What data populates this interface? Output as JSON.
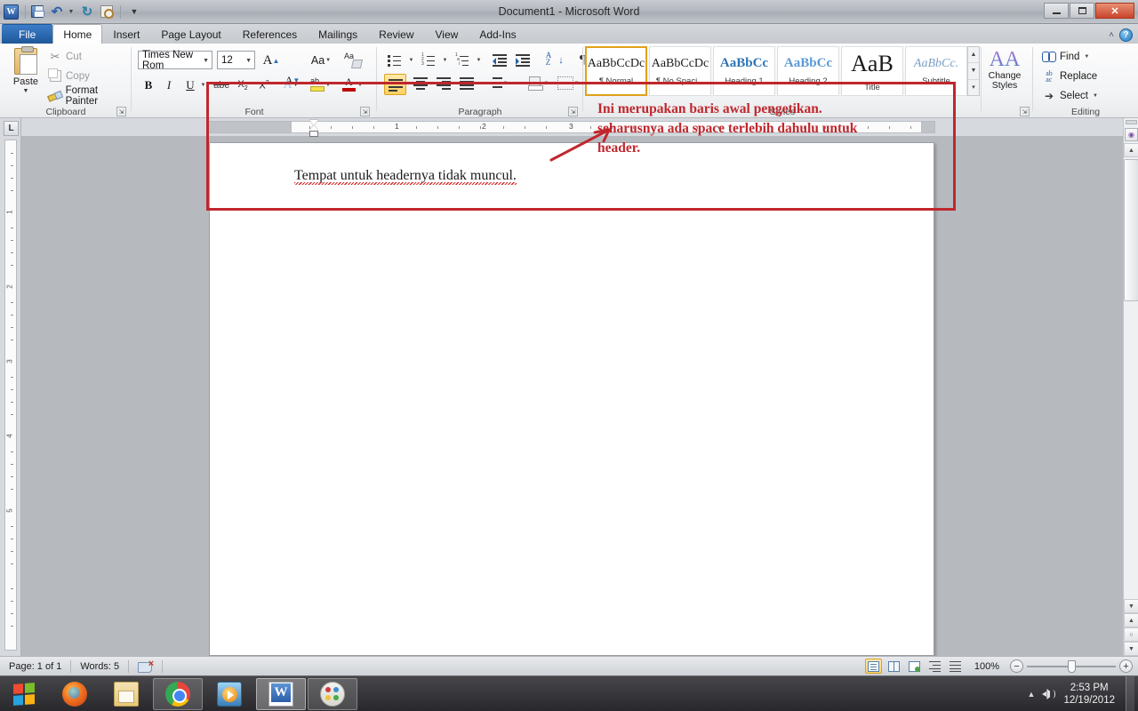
{
  "titlebar": {
    "app_icon": "word-logo",
    "document_title": "Document1  -  Microsoft Word",
    "qat": [
      {
        "name": "save",
        "icon": "save-icon",
        "label": "Save"
      },
      {
        "name": "undo",
        "icon": "undo-icon",
        "label": "Undo"
      },
      {
        "name": "redo",
        "icon": "redo-icon",
        "label": "Redo"
      },
      {
        "name": "print-preview",
        "icon": "print-preview-icon",
        "label": "Print Preview and Print"
      },
      {
        "name": "customize-qat",
        "icon": "chevron-down-icon",
        "label": "Customize Quick Access Toolbar"
      }
    ],
    "window_controls": [
      {
        "name": "minimize",
        "glyph": ""
      },
      {
        "name": "restore",
        "glyph": ""
      },
      {
        "name": "close",
        "glyph": "✕"
      }
    ]
  },
  "tabs": [
    {
      "label": "File",
      "active": false,
      "file": true
    },
    {
      "label": "Home",
      "active": true
    },
    {
      "label": "Insert",
      "active": false
    },
    {
      "label": "Page Layout",
      "active": false
    },
    {
      "label": "References",
      "active": false
    },
    {
      "label": "Mailings",
      "active": false
    },
    {
      "label": "Review",
      "active": false
    },
    {
      "label": "View",
      "active": false
    },
    {
      "label": "Add-Ins",
      "active": false
    }
  ],
  "tabstrip_right": {
    "collapse_ribbon": "˄",
    "help": "?"
  },
  "ribbon": {
    "clipboard": {
      "label": "Clipboard",
      "paste": "Paste",
      "cut": "Cut",
      "copy": "Copy",
      "format_painter": "Format Painter"
    },
    "font": {
      "label": "Font",
      "font_name": "Times New Rom",
      "font_size": "12",
      "grow_font": "A",
      "shrink_font": "A",
      "change_case": "Aa",
      "clear_formatting": "Clear Formatting",
      "bold": "B",
      "italic": "I",
      "underline": "U",
      "strikethrough": "abc",
      "subscript": "X",
      "superscript": "X",
      "text_effects": "A",
      "highlight": "Text Highlight Color",
      "font_color": "Font Color"
    },
    "paragraph": {
      "label": "Paragraph",
      "bullets": "Bullets",
      "numbering": "Numbering",
      "multilevel": "Multilevel List",
      "decrease_indent": "Decrease Indent",
      "increase_indent": "Increase Indent",
      "sort": "Sort",
      "show_marks": "¶",
      "align_left": "Align Text Left",
      "align_center": "Center",
      "align_right": "Align Text Right",
      "justify": "Justify",
      "line_spacing": "Line and Paragraph Spacing",
      "shading": "Shading",
      "borders": "Borders"
    },
    "styles": {
      "label": "Styles",
      "items": [
        {
          "preview": "AaBbCcDc",
          "name": "¶ Normal",
          "selected": true
        },
        {
          "preview": "AaBbCcDc",
          "name": "¶ No Spaci...",
          "selected": false
        },
        {
          "preview": "AaBbCс",
          "name": "Heading 1",
          "selected": false
        },
        {
          "preview": "AaBbCc",
          "name": "Heading 2",
          "selected": false
        },
        {
          "preview": "AaB",
          "name": "Title",
          "selected": false
        },
        {
          "preview": "AaBbCc.",
          "name": "Subtitle",
          "selected": false
        }
      ],
      "change_styles_line1": "Change",
      "change_styles_line2": "Styles"
    },
    "editing": {
      "label": "Editing",
      "find": "Find",
      "replace": "Replace",
      "select": "Select"
    }
  },
  "ruler": {
    "tab_selector": "L",
    "horizontal_numbers": [
      "1",
      "2",
      "3"
    ],
    "vertical_numbers": [
      "1",
      "2",
      "3",
      "4",
      "5"
    ]
  },
  "document": {
    "body_text": "Tempat untuk headernya tidak muncul."
  },
  "annotations": {
    "text_lines": [
      "Ini merupakan baris awal pengetikan.",
      "seharusnya ada space terlebih dahulu untuk",
      "header."
    ],
    "color": "#c0272d"
  },
  "statusbar": {
    "page": "Page: 1 of 1",
    "words": "Words: 5",
    "proofing": "Proofing Errors",
    "views": [
      {
        "name": "print-layout",
        "selected": true
      },
      {
        "name": "full-screen-reading",
        "selected": false
      },
      {
        "name": "web-layout",
        "selected": false
      },
      {
        "name": "outline",
        "selected": false
      },
      {
        "name": "draft",
        "selected": false
      }
    ],
    "zoom": "100%",
    "zoom_out": "−",
    "zoom_in": "+"
  },
  "taskbar": {
    "start": "Start",
    "items": [
      {
        "name": "firefox",
        "label": "Mozilla Firefox",
        "state": "pinned"
      },
      {
        "name": "file-explorer",
        "label": "Windows Explorer",
        "state": "pinned"
      },
      {
        "name": "chrome",
        "label": "Google Chrome",
        "state": "open"
      },
      {
        "name": "media-player",
        "label": "Windows Media Player",
        "state": "pinned"
      },
      {
        "name": "word",
        "label": "Microsoft Word",
        "state": "active"
      },
      {
        "name": "paint",
        "label": "Paint",
        "state": "open"
      }
    ],
    "tray": {
      "time": "2:53 PM",
      "date": "12/19/2012"
    }
  }
}
